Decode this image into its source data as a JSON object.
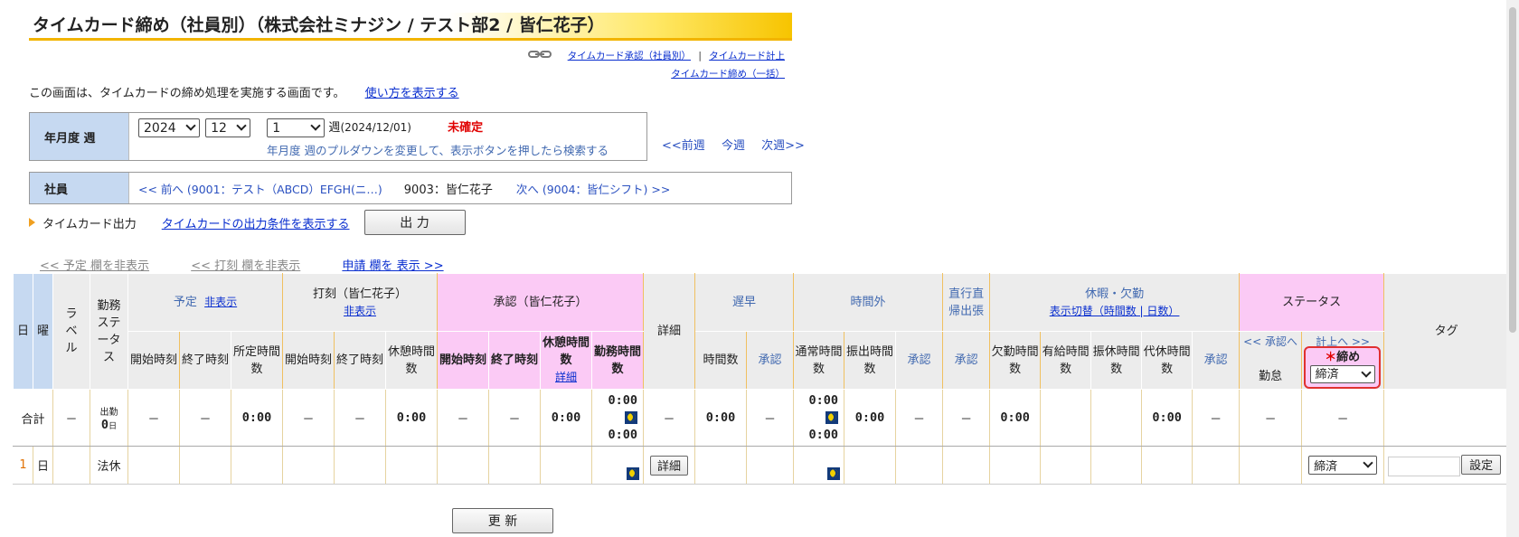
{
  "page": {
    "title": "タイムカード締め（社員別）（株式会社ミナジン / テスト部2 / 皆仁花子）",
    "links": {
      "approval": "タイムカード承認（社員別）",
      "sep": "|",
      "calc": "タイムカード計上",
      "bulk_close": "タイムカード締め（一括）"
    },
    "intro_text": "この画面は、タイムカードの締め処理を実施する画面です。",
    "intro_link": "使い方を表示する"
  },
  "period": {
    "label": "年月度 週",
    "year": "2024",
    "month": "12",
    "week": "1",
    "week_suffix": "週",
    "week_date": "(2024/12/01)",
    "status": "未確定",
    "hint": "年月度 週のプルダウンを変更して、表示ボタンを押したら検索する"
  },
  "week_nav": {
    "prev": "<<前週",
    "current": "今週",
    "next": "次週>>"
  },
  "employee": {
    "label": "社員",
    "prev": "<< 前へ (9001：テスト（ABCD）EFGH(ニ…)",
    "current": "9003：皆仁花子",
    "next": "次へ (9004：皆仁シフト) >>"
  },
  "output": {
    "label": "タイムカード出力",
    "link": "タイムカードの出力条件を表示する",
    "button": "出 力"
  },
  "toggles": {
    "hide_plan": "<< 予定 欄を非表示",
    "hide_stamp": "<< 打刻 欄を非表示",
    "show_request": "申請 欄を 表示 >>"
  },
  "table": {
    "head": {
      "day": "日",
      "weekday": "曜",
      "label": "ラベル",
      "work_status": "勤務ステータス",
      "plan": "予定",
      "plan_hide": "非表示",
      "stamp": "打刻（皆仁花子）",
      "stamp_hide": "非表示",
      "approval": "承認（皆仁花子）",
      "detail": "詳細",
      "late": "遅早",
      "overtime": "時間外",
      "direct": "直行直帰出張",
      "leave": "休暇・欠勤",
      "leave_toggle": "表示切替（時間数 | 日数）",
      "status": "ステータス",
      "tag": "タグ",
      "start": "開始時刻",
      "end": "終了時刻",
      "scheduled": "所定時間数",
      "break": "休憩時間数",
      "work": "勤務時間数",
      "break_detail": "詳細",
      "hours": "時間数",
      "approve": "承認",
      "normal": "通常時間数",
      "transfer": "振出時間数",
      "absent": "欠勤時間数",
      "paid": "有給時間数",
      "compensatory": "振休時間数",
      "substitute": "代休時間数",
      "to_approval": "<< 承認へ",
      "to_calc": "計上へ >>",
      "attendance": "勤怠",
      "close_mark": "＊",
      "close": "締め",
      "close_select": "締済"
    },
    "summary": {
      "label": "合計",
      "dash": "－",
      "work_status_top": "出勤",
      "work_days": "0",
      "days_unit": "日",
      "zero": "0:00"
    },
    "rows": [
      {
        "day": "1",
        "weekday": "日",
        "status": "法休",
        "detail_button": "詳細",
        "close": "締済",
        "tag_button": "設定",
        "tag_value": ""
      }
    ]
  },
  "update_button": "更 新",
  "colors": {
    "header_blue": "#c6d9f1",
    "header_gray": "#ececec",
    "header_pink": "#fbcaf5",
    "status_red": "#e00000",
    "title_accent": "#f2b400"
  }
}
